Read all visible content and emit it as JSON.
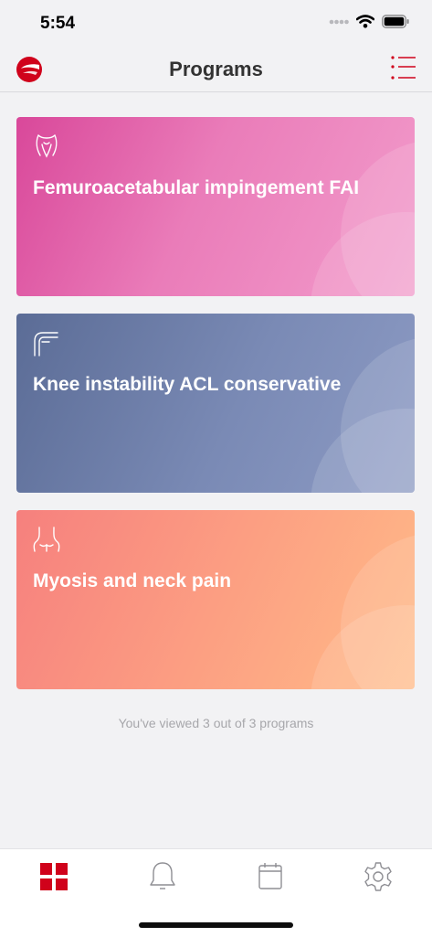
{
  "status_bar": {
    "time": "5:54"
  },
  "header": {
    "title": "Programs"
  },
  "programs": [
    {
      "title": "Femuroacetabular impingement FAI",
      "icon": "hip-icon"
    },
    {
      "title": "Knee instability ACL conservative",
      "icon": "knee-icon"
    },
    {
      "title": "Myosis and neck pain",
      "icon": "neck-icon"
    }
  ],
  "footer": {
    "viewed_text": "You've viewed 3 out of 3 programs"
  },
  "tabs": [
    {
      "name": "programs",
      "icon": "grid-icon",
      "active": true
    },
    {
      "name": "notifications",
      "icon": "bell-icon",
      "active": false
    },
    {
      "name": "calendar",
      "icon": "calendar-icon",
      "active": false
    },
    {
      "name": "settings",
      "icon": "gear-icon",
      "active": false
    }
  ],
  "colors": {
    "accent": "#d0021b",
    "inactive_icon": "#8e8e93"
  }
}
